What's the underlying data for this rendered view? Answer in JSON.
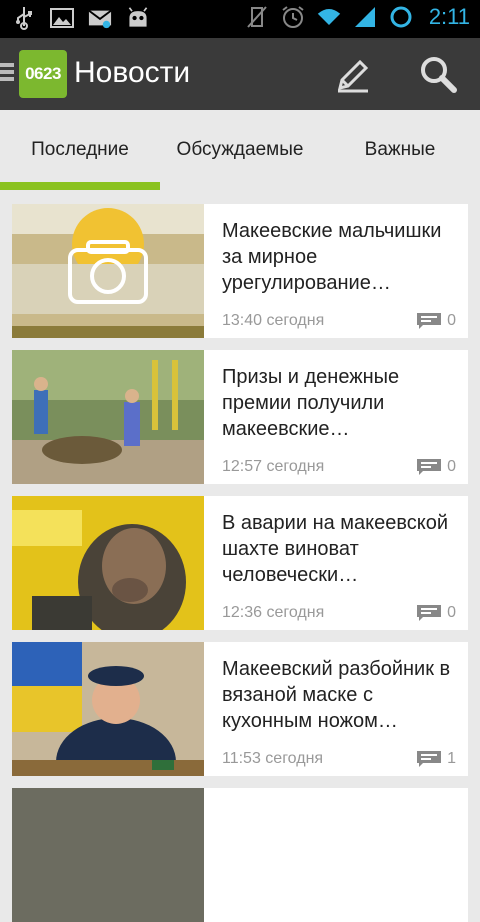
{
  "status_bar": {
    "time": "2:11",
    "accent": "#33b5e5",
    "icons_left": [
      "usb-icon",
      "image-icon",
      "mail-icon",
      "android-debug-icon"
    ],
    "icons_right": [
      "vibrate-off-icon",
      "alarm-icon",
      "wifi-icon",
      "signal-icon",
      "sync-icon"
    ]
  },
  "action_bar": {
    "logo_text": "0623",
    "title": "Новости",
    "logo_color": "#7cb82f",
    "background": "#3a3a3a"
  },
  "tabs": [
    {
      "label": "Последние",
      "selected": true
    },
    {
      "label": "Обсуждаемые",
      "selected": false
    },
    {
      "label": "Важные",
      "selected": false
    }
  ],
  "indicator_color": "#8bc21f",
  "articles": [
    {
      "title": "Макеевские мальчишки за мирное урегулирование…",
      "time": "13:40 сегодня",
      "comments": "0",
      "thumb": "photo-placeholder-camera"
    },
    {
      "title": "Призы и денежные премии получили макеевские…",
      "time": "12:57 сегодня",
      "comments": "0",
      "thumb": "kids-playground-photo"
    },
    {
      "title": "В аварии на макеевской шахте виноват человечески…",
      "time": "12:36 сегодня",
      "comments": "0",
      "thumb": "miner-photo"
    },
    {
      "title": "Макеевский разбойник в вязаной маске с кухонным ножом…",
      "time": "11:53 сегодня",
      "comments": "1",
      "thumb": "police-officer-photo"
    }
  ]
}
